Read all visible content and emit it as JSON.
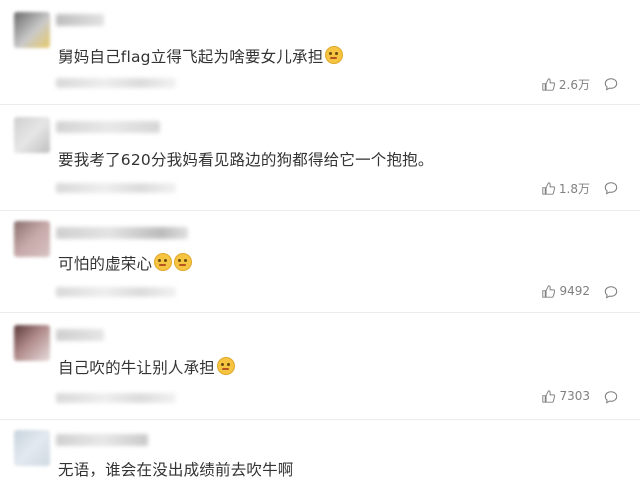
{
  "comments": [
    {
      "text": "舅妈自己flag立得飞起为啥要女儿承担",
      "likes": "2.6万",
      "emoji_count": 1
    },
    {
      "text": "要我考了620分我妈看见路边的狗都得给它一个抱抱。",
      "likes": "1.8万",
      "emoji_count": 0
    },
    {
      "text": "可怕的虚荣心",
      "likes": "9492",
      "emoji_count": 2
    },
    {
      "text": "自己吹的牛让别人承担",
      "likes": "7303",
      "emoji_count": 1
    },
    {
      "text": "无语，谁会在没出成绩前去吹牛啊",
      "likes": "",
      "emoji_count": 0
    }
  ],
  "icons": {
    "like": "thumbs-up-icon",
    "reply": "comment-bubble-icon",
    "emoji": "smiley-face-emoji"
  }
}
